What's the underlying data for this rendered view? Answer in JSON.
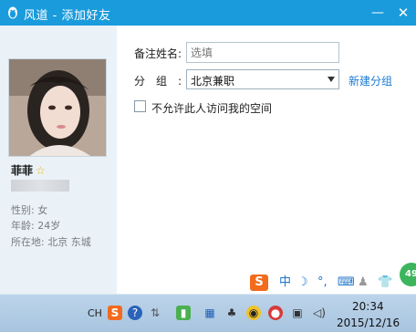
{
  "window": {
    "title": "风道 - 添加好友",
    "min_glyph": "—",
    "close_glyph": "✕"
  },
  "profile": {
    "name": "菲菲",
    "gender": "性别: 女",
    "age": "年龄: 24岁",
    "location": "所在地: 北京  东城"
  },
  "form": {
    "remark_label": "备注姓名:",
    "remark_placeholder": "选填",
    "group_label": "分组:",
    "group_value": "北京兼职",
    "new_group_link": "新建分组",
    "privacy_checkbox_label": "不允许此人访问我的空间",
    "privacy_checked": false
  },
  "ime_bar": {
    "logo": "S",
    "mode": "中"
  },
  "notification_badge": "49",
  "taskbar": {
    "language": "CH",
    "time": "20:34",
    "date": "2015/12/16"
  },
  "colors": {
    "titlebar": "#1a9bdc",
    "link": "#1a7bd4",
    "ime_logo": "#f26b1d",
    "badge": "#3cb55c"
  }
}
